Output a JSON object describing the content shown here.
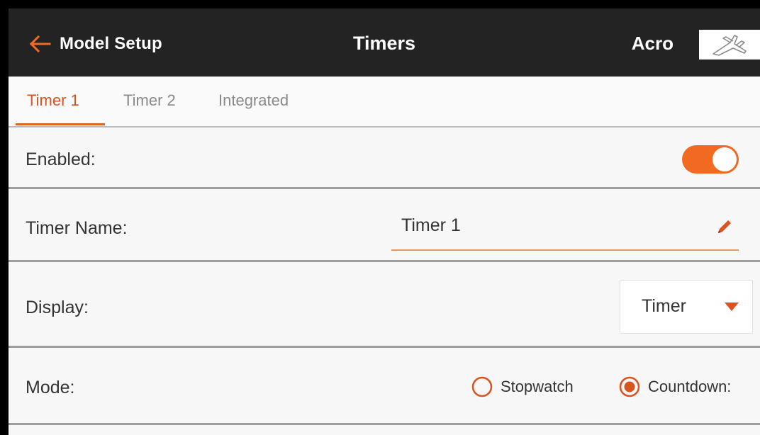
{
  "header": {
    "back_label": "Model Setup",
    "title": "Timers",
    "model_name": "Acro",
    "back_icon": "arrow-left-icon",
    "model_icon": "airplane-icon"
  },
  "tabs": [
    {
      "label": "Timer 1",
      "active": true
    },
    {
      "label": "Timer 2",
      "active": false
    },
    {
      "label": "Integrated",
      "active": false
    }
  ],
  "enabled": {
    "label": "Enabled:",
    "value": true
  },
  "timer_name": {
    "label": "Timer Name:",
    "value": "Timer 1",
    "icon": "pencil-icon"
  },
  "display": {
    "label": "Display:",
    "selected": "Timer",
    "icon": "caret-down-icon"
  },
  "mode": {
    "label": "Mode:",
    "options": [
      {
        "label": "Stopwatch",
        "selected": false
      },
      {
        "label": "Countdown:",
        "selected": true
      }
    ]
  },
  "colors": {
    "accent": "#f26a21",
    "header_bg": "#232323",
    "active_tab": "#d9541e"
  }
}
